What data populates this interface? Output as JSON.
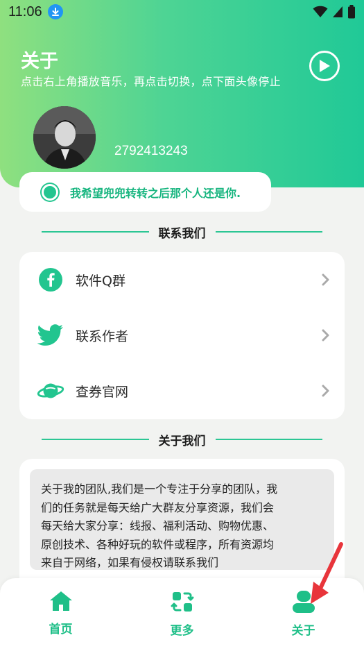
{
  "status_bar": {
    "time": "11:06",
    "icons": [
      "download-icon",
      "wifi-icon",
      "signal-icon",
      "battery-icon"
    ]
  },
  "header": {
    "title": "关于",
    "subtitle": "点击右上角播放音乐，再点击切换，点下面头像停止",
    "play_icon": "play-circle-icon",
    "qq_number": "2792413243"
  },
  "motto": {
    "text": "我希望兜兜转转之后那个人还是你."
  },
  "contact_section": {
    "heading": "联系我们",
    "items": [
      {
        "label": "软件Q群",
        "icon": "facebook-icon"
      },
      {
        "label": "联系作者",
        "icon": "twitter-icon"
      },
      {
        "label": "查券官网",
        "icon": "planet-icon"
      }
    ]
  },
  "about_section": {
    "heading": "关于我们",
    "lines": [
      "关于我的团队,我们是一个专注于分享的团队，我",
      "们的任务就是每天给广大群友分享资源，我们会",
      "每天给大家分享：线报、福利活动、购物优惠、",
      "原创技术、各种好玩的软件或程序，所有资源均",
      "来自于网络，如果有侵权请联系我们"
    ]
  },
  "bottom_nav": {
    "items": [
      {
        "label": "首页",
        "icon": "home-icon"
      },
      {
        "label": "更多",
        "icon": "switch-icon"
      },
      {
        "label": "关于",
        "icon": "user-icon",
        "active": true
      }
    ]
  },
  "colors": {
    "accent": "#22c58f",
    "header_gradient_start": "#8fe07f",
    "header_gradient_end": "#20c997",
    "annotation_arrow": "#e8353b"
  }
}
